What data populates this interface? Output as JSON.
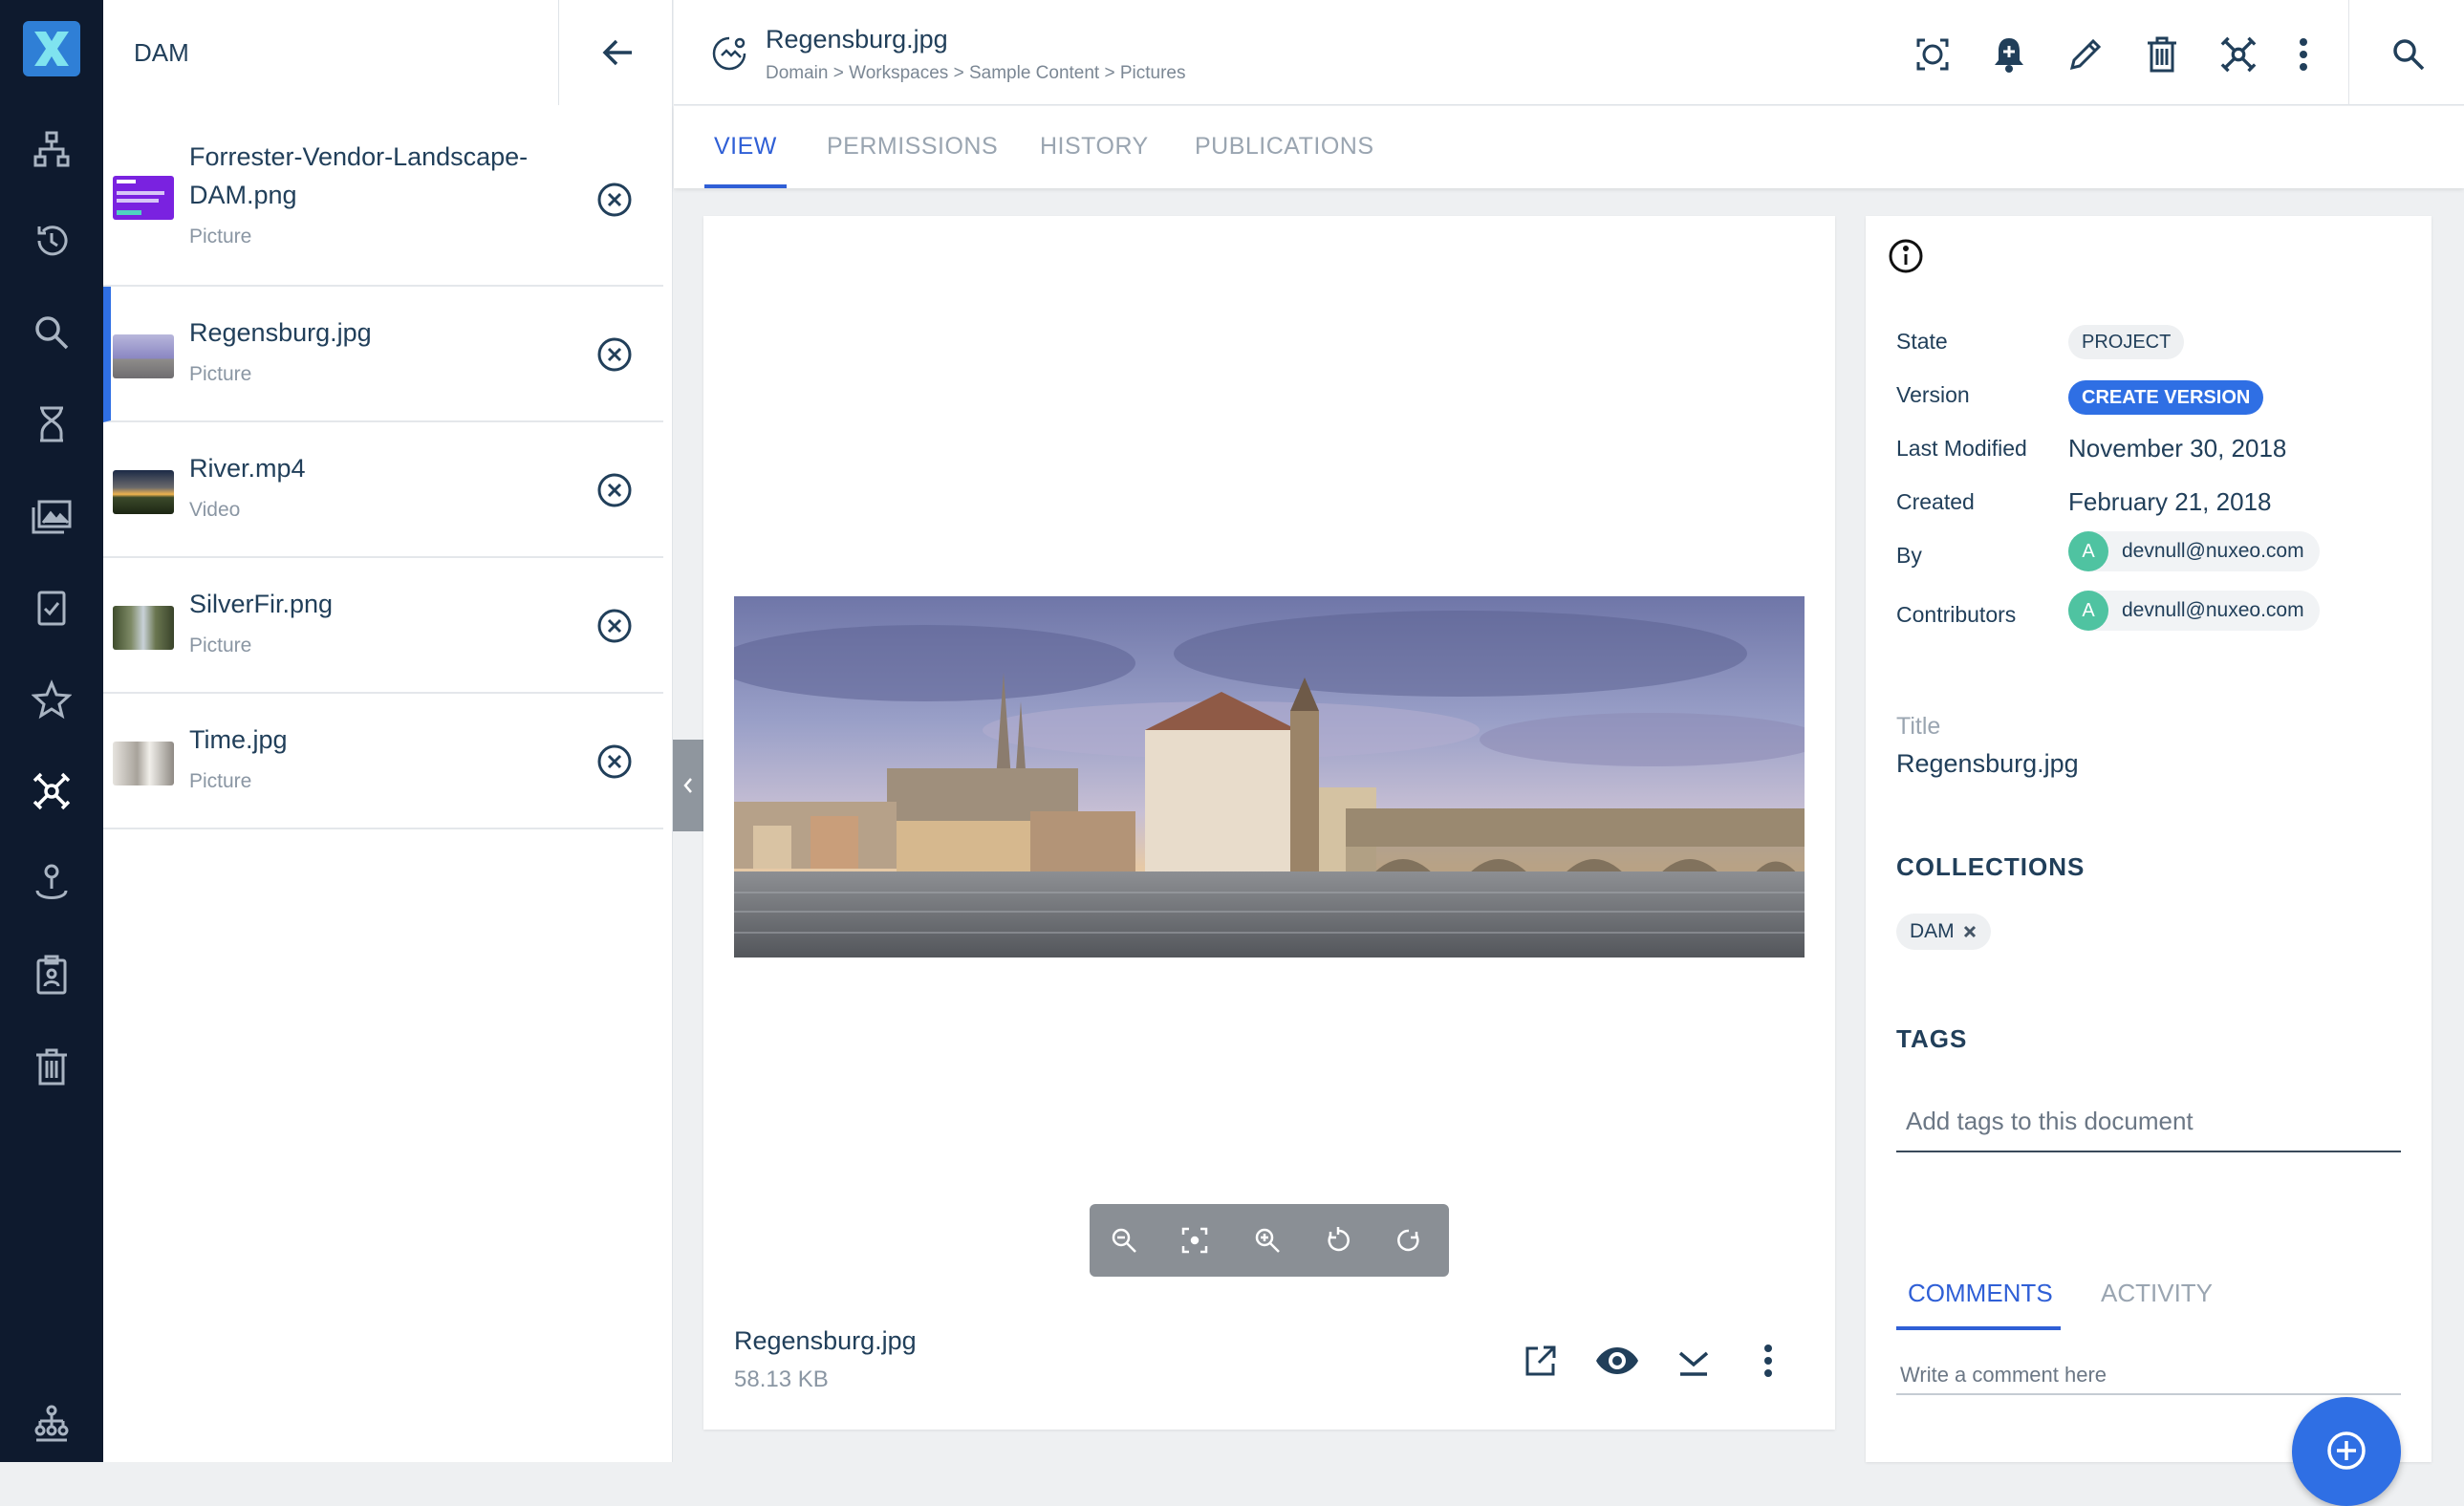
{
  "colors": {
    "rail_bg": "#0e1a2e",
    "accent": "#2f6fe4",
    "tab_active": "#2f5fd6",
    "avatar": "#4fc3a1"
  },
  "rail": {
    "icons": [
      "nuxeo-logo-icon",
      "browse-icon",
      "history-icon",
      "search-icon",
      "expired-icon",
      "pictures-icon",
      "tasks-icon",
      "favorites-icon",
      "collections-icon",
      "personal-workspace-icon",
      "clipboard-icon",
      "trash-icon",
      "administration-icon"
    ]
  },
  "drawer": {
    "title": "DAM",
    "items": [
      {
        "name": "Forrester-Vendor-Landscape-DAM.png",
        "type": "Picture"
      },
      {
        "name": "Regensburg.jpg",
        "type": "Picture"
      },
      {
        "name": "River.mp4",
        "type": "Video"
      },
      {
        "name": "SilverFir.png",
        "type": "Picture"
      },
      {
        "name": "Time.jpg",
        "type": "Picture"
      }
    ]
  },
  "header": {
    "title": "Regensburg.jpg",
    "breadcrumb": "Domain > Workspaces > Sample Content > Pictures",
    "actions": [
      "preview-icon",
      "follow-icon",
      "edit-icon",
      "delete-icon",
      "add-to-collection-icon",
      "more-icon"
    ]
  },
  "tabs": [
    "VIEW",
    "PERMISSIONS",
    "HISTORY",
    "PUBLICATIONS"
  ],
  "viewer": {
    "zoom_controls": [
      "zoom-out-icon",
      "fit-icon",
      "zoom-in-icon",
      "rotate-left-icon",
      "rotate-right-icon"
    ],
    "file_name": "Regensburg.jpg",
    "file_size": "58.13 KB",
    "file_actions": [
      "open-external-icon",
      "preview-icon",
      "download-icon",
      "more-icon"
    ]
  },
  "metadata": {
    "state_label": "State",
    "state_value": "PROJECT",
    "version_label": "Version",
    "version_button": "CREATE VERSION",
    "last_modified_label": "Last Modified",
    "last_modified_value": "November 30, 2018",
    "created_label": "Created",
    "created_value": "February 21, 2018",
    "by_label": "By",
    "by_avatar": "A",
    "by_user": "devnull@nuxeo.com",
    "contributors_label": "Contributors",
    "contributor_avatar": "A",
    "contributor_user": "devnull@nuxeo.com",
    "title_label": "Title",
    "title_value": "Regensburg.jpg",
    "collections_heading": "COLLECTIONS",
    "collection_chip": "DAM",
    "tags_heading": "TAGS",
    "tags_placeholder": "Add tags to this document",
    "comment_tabs": [
      "COMMENTS",
      "ACTIVITY"
    ],
    "comment_placeholder": "Write a comment here"
  }
}
